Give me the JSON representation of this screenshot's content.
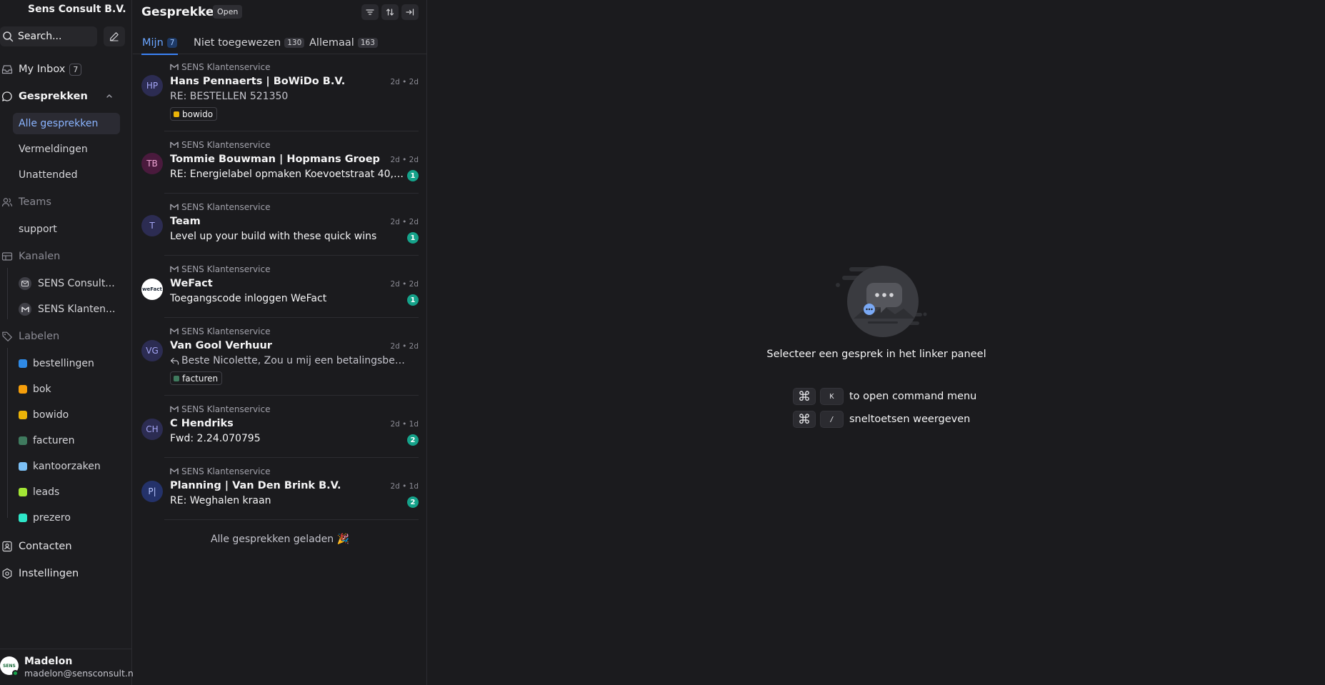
{
  "sidebar": {
    "account_name": "Sens Consult B.V.",
    "search_placeholder": "Search...",
    "my_inbox": {
      "label": "My Inbox",
      "count": "7"
    },
    "conversations": {
      "label": "Gesprekken",
      "items": [
        {
          "label": "Alle gesprekken",
          "active": true
        },
        {
          "label": "Vermeldingen"
        },
        {
          "label": "Unattended"
        }
      ]
    },
    "teams": {
      "label": "Teams",
      "items": [
        {
          "label": "support"
        }
      ]
    },
    "channels": {
      "label": "Kanalen",
      "items": [
        {
          "label": "SENS Consult..."
        },
        {
          "label": "SENS Klanten..."
        }
      ]
    },
    "labels": {
      "label": "Labelen",
      "items": [
        {
          "label": "bestellingen",
          "color": "#2f8ae6"
        },
        {
          "label": "bok",
          "color": "#f59e0b"
        },
        {
          "label": "bowido",
          "color": "#eab308"
        },
        {
          "label": "facturen",
          "color": "#3f7a5e"
        },
        {
          "label": "kantoorzaken",
          "color": "#7cc0f5"
        },
        {
          "label": "leads",
          "color": "#a3e635"
        },
        {
          "label": "prezero",
          "color": "#2ee6c8"
        }
      ]
    },
    "contacts": {
      "label": "Contacten"
    },
    "settings": {
      "label": "Instellingen"
    },
    "user": {
      "name": "Madelon",
      "email": "madelon@sensconsult.nl",
      "avatar_text": "SENS"
    }
  },
  "list": {
    "title": "Gesprekken",
    "status": "Open",
    "tabs": [
      {
        "label": "Mijn",
        "count": "7",
        "active": true
      },
      {
        "label": "Niet toegewezen",
        "count": "130"
      },
      {
        "label": "Allemaal",
        "count": "163"
      }
    ],
    "conversations": [
      {
        "inbox": "SENS Klantenservice",
        "initials": "HP",
        "name": "Hans Pennaerts | BoWiDo B.V.",
        "time": "2d • 2d",
        "message": "RE: BESTELLEN 521350",
        "label": {
          "text": "bowido",
          "color": "#eab308"
        }
      },
      {
        "inbox": "SENS Klantenservice",
        "initials": "TB",
        "name": "Tommie Bouwman | Hopmans Groep",
        "time": "2d • 2d",
        "message": "RE: Energielabel opmaken Koevoetstraat 40, B...",
        "unread": "1"
      },
      {
        "inbox": "SENS Klantenservice",
        "initials": "T",
        "name": "Team",
        "time": "2d • 2d",
        "message": "Level up your build with these quick wins",
        "unread": "1"
      },
      {
        "inbox": "SENS Klantenservice",
        "initials": "weFact",
        "name": "WeFact",
        "time": "2d • 2d",
        "message": "Toegangscode inloggen WeFact",
        "unread": "1"
      },
      {
        "inbox": "SENS Klantenservice",
        "initials": "VG",
        "name": "Van Gool Verhuur",
        "time": "2d • 2d",
        "message": "Beste Nicolette, Zou u mij een betalingsbewijs ...",
        "label": {
          "text": "facturen",
          "color": "#3f7a5e"
        }
      },
      {
        "inbox": "SENS Klantenservice",
        "initials": "CH",
        "name": "C Hendriks",
        "time": "2d • 1d",
        "message": "Fwd: 2.24.070795",
        "unread": "2"
      },
      {
        "inbox": "SENS Klantenservice",
        "initials": "P|",
        "name": "Planning | Van Den Brink B.V.",
        "time": "2d • 1d",
        "message": "RE: Weghalen kraan",
        "unread": "2"
      }
    ],
    "all_loaded": "Alle gesprekken geladen 🎉"
  },
  "main": {
    "empty_text": "Selecteer een gesprek in het linker paneel",
    "shortcuts": [
      {
        "key1": "⌘",
        "key2": "K",
        "label": "to open command menu"
      },
      {
        "key1": "⌘",
        "key2": "/",
        "label": "sneltoetsen weergeven"
      }
    ]
  }
}
